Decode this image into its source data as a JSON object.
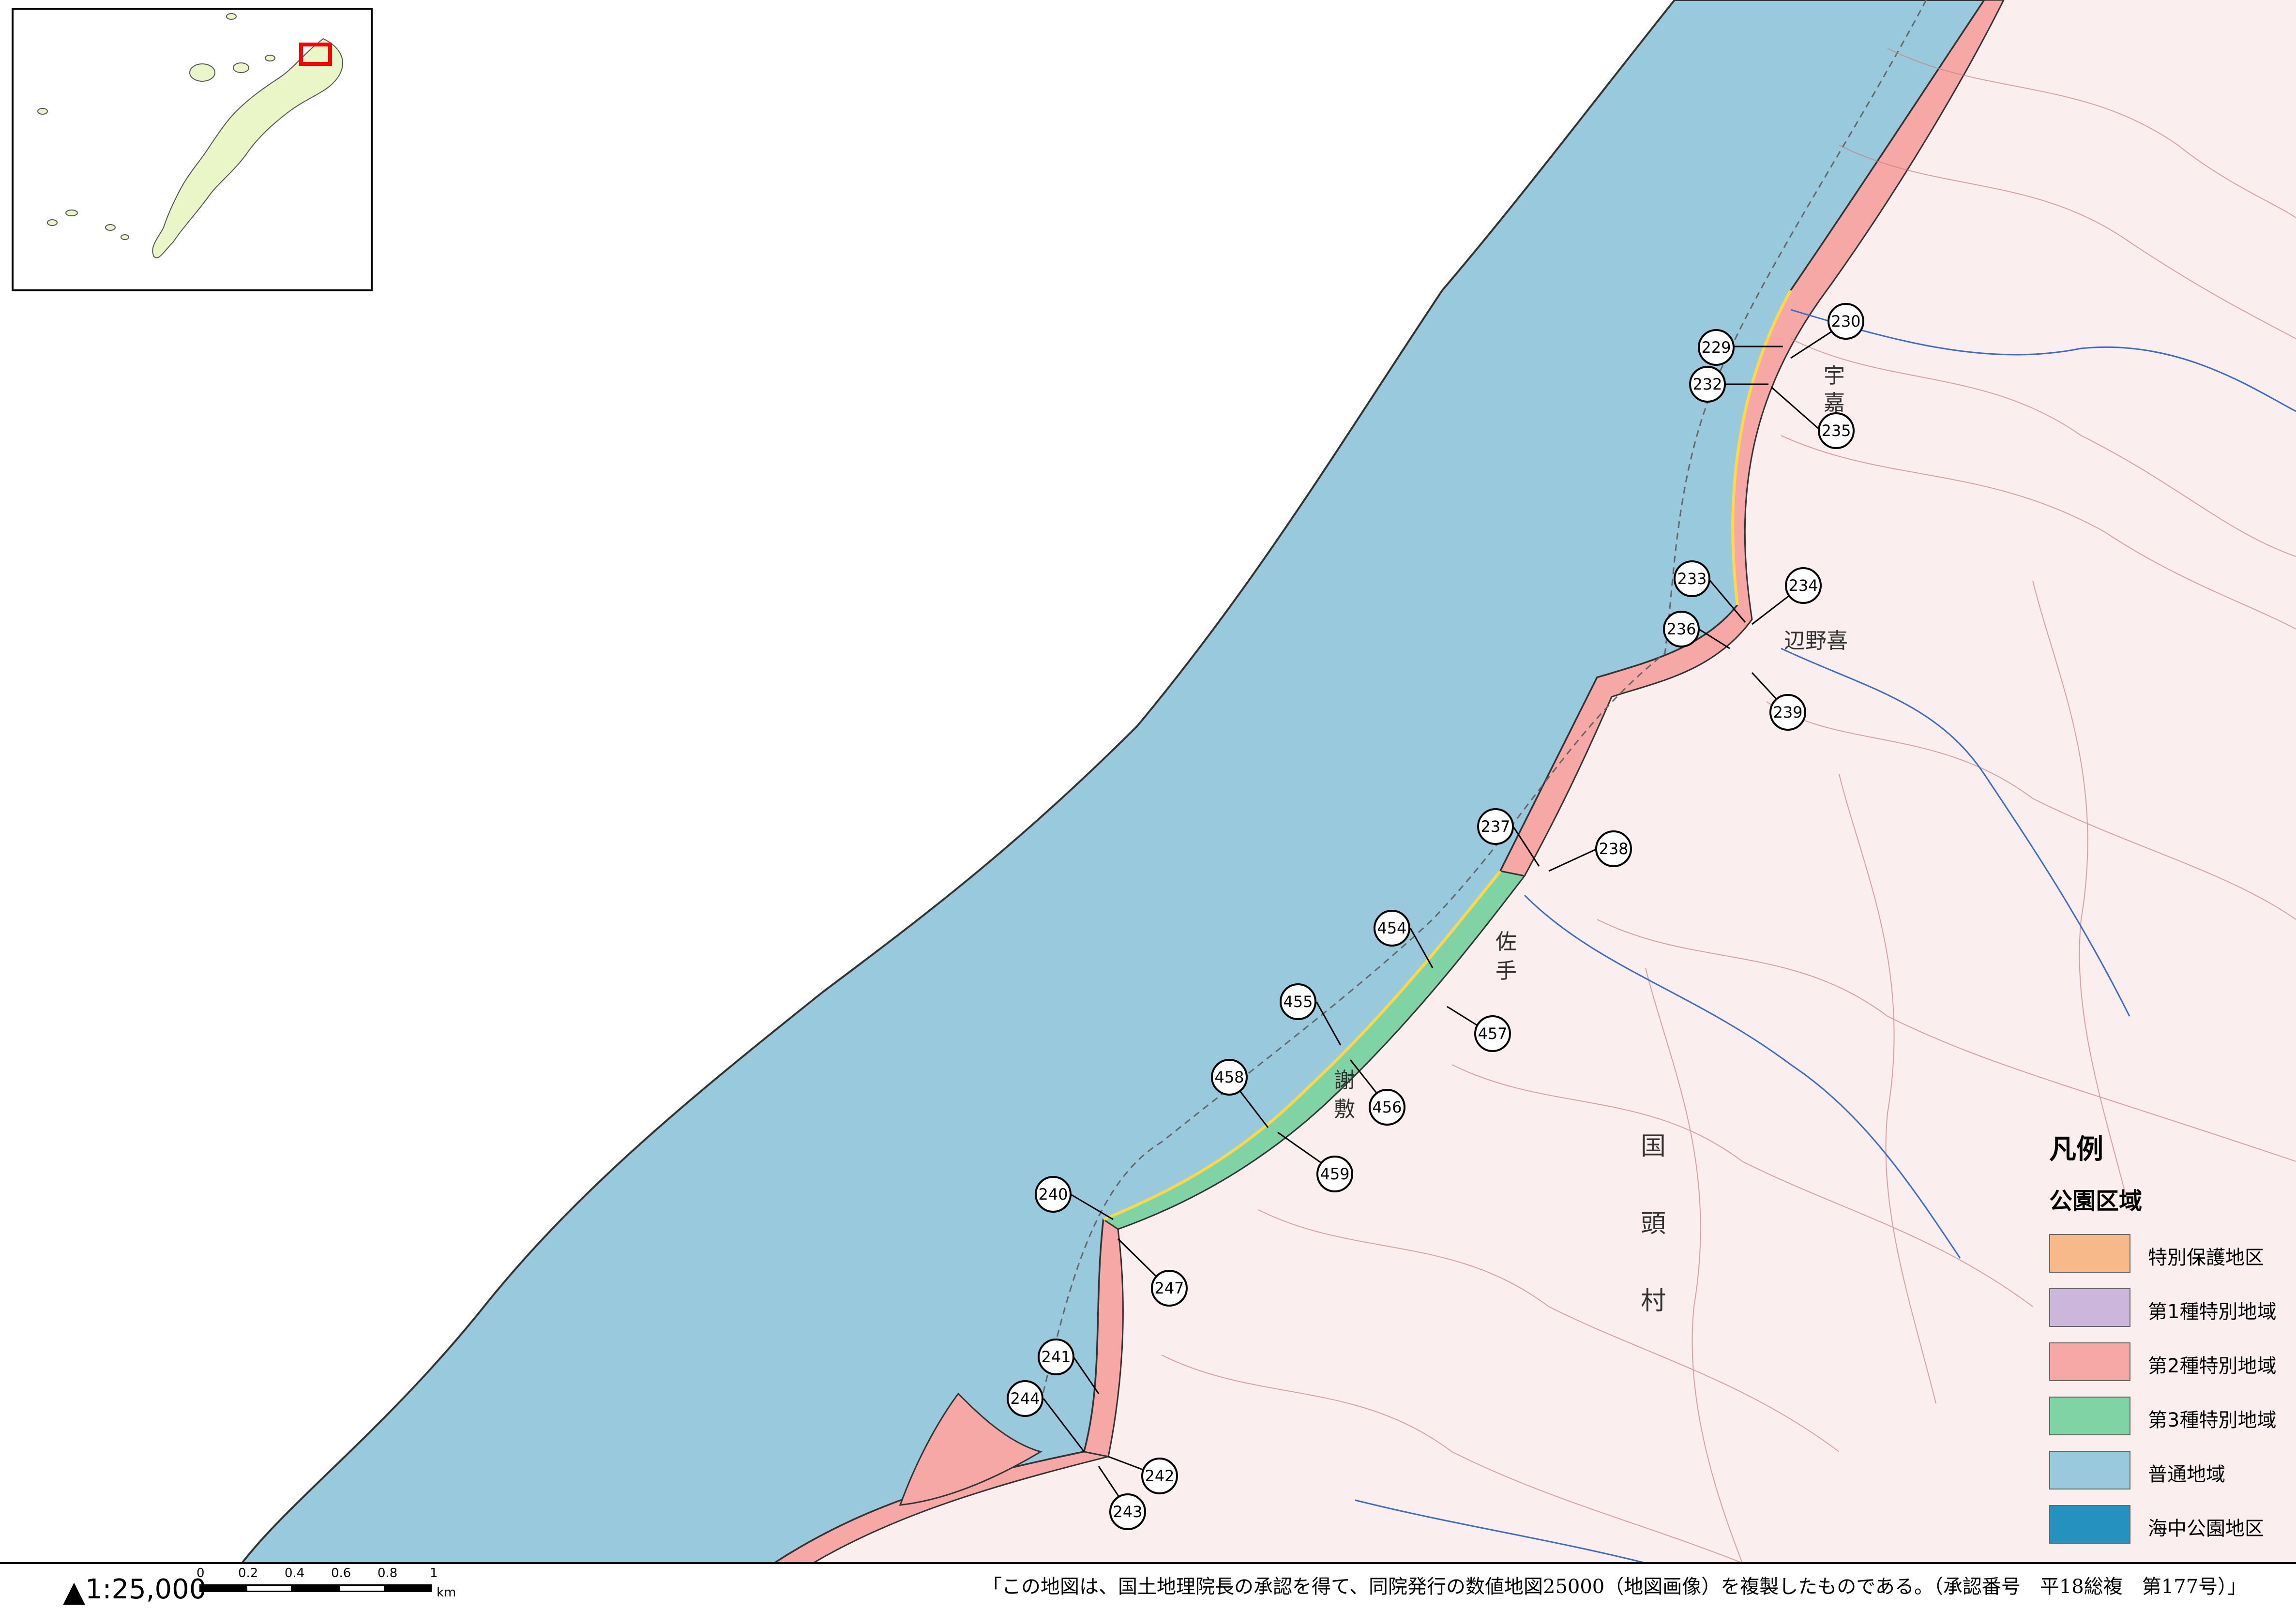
{
  "inset": {
    "highlight_color": "#ff0000",
    "land_color": "#eaf5c8"
  },
  "legend": {
    "title": "凡例",
    "subtitle": "公園区域",
    "items": [
      {
        "label": "特別保護地区",
        "color": "#f7b98a"
      },
      {
        "label": "第1種特別地域",
        "color": "#cdb6dc"
      },
      {
        "label": "第2種特別地域",
        "color": "#f6a8a6"
      },
      {
        "label": "第3種特別地域",
        "color": "#7fd3a4"
      },
      {
        "label": "普通地域",
        "color": "#98c9dc"
      },
      {
        "label": "海中公園地区",
        "color": "#2591bf"
      }
    ]
  },
  "scale": {
    "north": "▲",
    "label": "1:25,000",
    "ticks": [
      "0",
      "0.2",
      "0.4",
      "0.6",
      "0.8",
      "1"
    ],
    "unit": "km"
  },
  "copyright": "「この地図は、国土地理院長の承認を得て、同院発行の数値地図25000（地図画像）を複製したものである。（承認番号　平18総複　第177号）」",
  "place_names": {
    "uka_1": "宇",
    "uka_2": "嘉",
    "henoki": "辺野喜",
    "sate_1": "佐",
    "sate_2": "手",
    "gushiki_1": "謝",
    "gushiki_2": "敷",
    "kunigami_1": "国",
    "kunigami_2": "頭",
    "kunigami_3": "村"
  },
  "callouts": [
    "229",
    "230",
    "232",
    "235",
    "233",
    "234",
    "236",
    "239",
    "237",
    "238",
    "454",
    "455",
    "457",
    "456",
    "458",
    "459",
    "240",
    "247",
    "241",
    "244",
    "242",
    "243"
  ],
  "colors": {
    "sea": "#98c9dc",
    "land": "#fbeeee",
    "contour": "#c98080",
    "coast_band": "#f6a8a6",
    "green_band": "#7fd3a4",
    "yellow_line": "#ffd84a"
  }
}
